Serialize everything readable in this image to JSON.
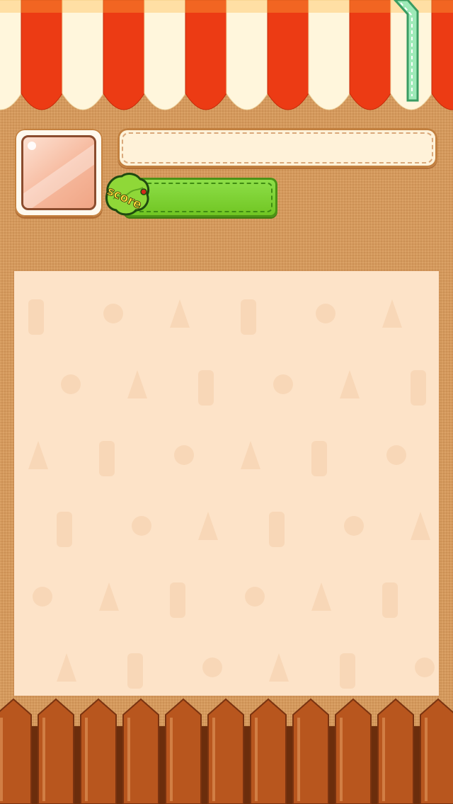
{
  "hud": {
    "player_name": "",
    "score_label": "score",
    "score_value": ""
  },
  "colors": {
    "awning_red": "#ec3b14",
    "awning_cream": "#fff6dc",
    "background_tan": "#d99a5a",
    "score_green": "#7bd02e",
    "board_peach": "#fde3c8",
    "fence_wood": "#b8561e",
    "straw_green": "#8fe3b0"
  },
  "icons": {
    "portrait": "portrait-frame-icon",
    "score_badge": "leaf-score-badge-icon",
    "straw": "straw-icon"
  }
}
